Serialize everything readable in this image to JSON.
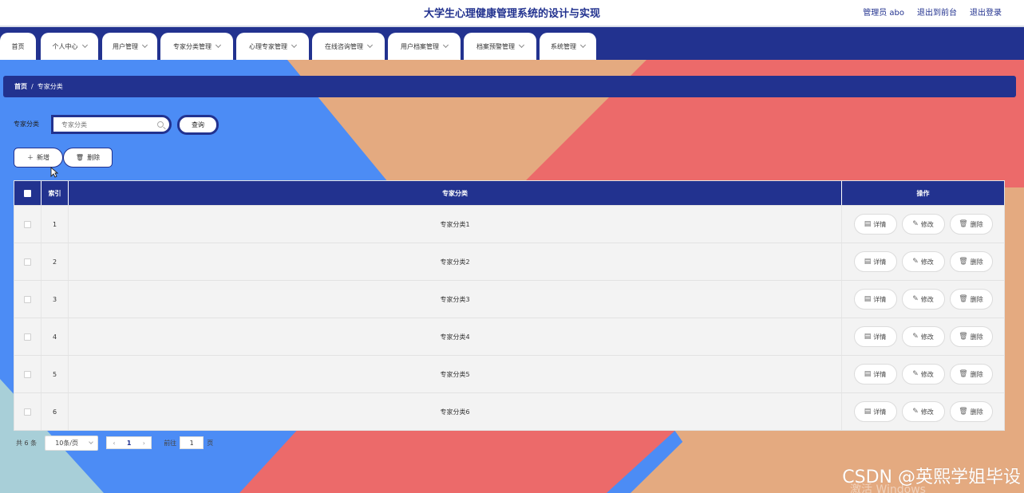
{
  "app": {
    "title": "大学生心理健康管理系统的设计与实现",
    "user_label": "管理员 abo",
    "to_front_label": "退出到前台",
    "logout_label": "退出登录"
  },
  "nav": {
    "items": [
      {
        "label": "首页",
        "has_menu": false
      },
      {
        "label": "个人中心",
        "has_menu": true
      },
      {
        "label": "用户管理",
        "has_menu": true
      },
      {
        "label": "专家分类管理",
        "has_menu": true
      },
      {
        "label": "心理专家管理",
        "has_menu": true
      },
      {
        "label": "在线咨询管理",
        "has_menu": true
      },
      {
        "label": "用户档案管理",
        "has_menu": true
      },
      {
        "label": "档案预警管理",
        "has_menu": true
      },
      {
        "label": "系统管理",
        "has_menu": true
      }
    ]
  },
  "breadcrumb": {
    "home": "首页",
    "separator": "/",
    "current": "专家分类"
  },
  "search": {
    "label": "专家分类",
    "placeholder": "专家分类",
    "value": "",
    "query_label": "查询"
  },
  "actions": {
    "add_label": "新增",
    "delete_label": "删除"
  },
  "table": {
    "headers": {
      "index": "索引",
      "category": "专家分类",
      "ops": "操作"
    },
    "rows": [
      {
        "index": "1",
        "category": "专家分类1"
      },
      {
        "index": "2",
        "category": "专家分类2"
      },
      {
        "index": "3",
        "category": "专家分类3"
      },
      {
        "index": "4",
        "category": "专家分类4"
      },
      {
        "index": "5",
        "category": "专家分类5"
      },
      {
        "index": "6",
        "category": "专家分类6"
      }
    ],
    "op_labels": {
      "detail": "详情",
      "edit": "修改",
      "delete": "删除"
    }
  },
  "pager": {
    "total": "共 6 条",
    "page_size": "10条/页",
    "current_page": "1",
    "goto_label": "前往",
    "goto_value": "1",
    "page_suffix": "页"
  },
  "watermark": {
    "text": "CSDN @英熙学姐毕设",
    "text2": "激活 Windows"
  },
  "colors": {
    "primary": "#22328f",
    "bg_blue": "#4c8cf5",
    "bg_peach": "#e4aa80",
    "bg_red": "#ec6a6a",
    "bg_teal": "#a8cfd8"
  }
}
